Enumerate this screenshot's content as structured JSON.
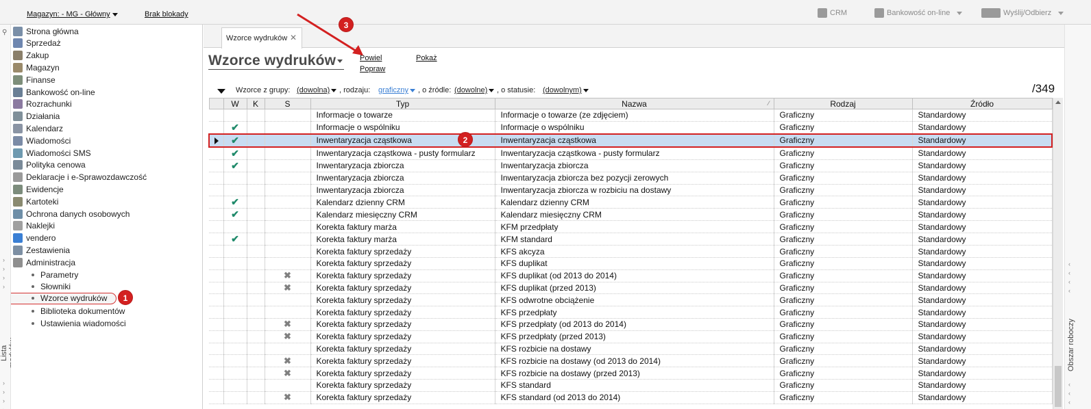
{
  "topbar": {
    "warehouse": "Magazyn: - MG - Główny",
    "lock": "Brak blokady",
    "crm": "CRM",
    "banking": "Bankowość on-line",
    "send": "Wyślij/Odbierz"
  },
  "left_strip": {
    "label": "Lista modułów"
  },
  "right_strip": {
    "label": "Obszar roboczy"
  },
  "sidebar": {
    "modules": [
      {
        "label": "Strona główna",
        "icon": "home-icon"
      },
      {
        "label": "Sprzedaż",
        "icon": "sales-icon"
      },
      {
        "label": "Zakup",
        "icon": "purchase-icon"
      },
      {
        "label": "Magazyn",
        "icon": "warehouse-icon"
      },
      {
        "label": "Finanse",
        "icon": "finance-icon"
      },
      {
        "label": "Bankowość on-line",
        "icon": "bank-icon"
      },
      {
        "label": "Rozrachunki",
        "icon": "settlements-icon"
      },
      {
        "label": "Działania",
        "icon": "actions-icon"
      },
      {
        "label": "Kalendarz",
        "icon": "calendar-icon"
      },
      {
        "label": "Wiadomości",
        "icon": "messages-icon"
      },
      {
        "label": "Wiadomości SMS",
        "icon": "sms-icon"
      },
      {
        "label": "Polityka cenowa",
        "icon": "pricing-icon"
      },
      {
        "label": "Deklaracje i e-Sprawozdawczość",
        "icon": "declarations-icon"
      },
      {
        "label": "Ewidencje",
        "icon": "records-icon"
      },
      {
        "label": "Kartoteki",
        "icon": "cards-icon"
      },
      {
        "label": "Ochrona danych osobowych",
        "icon": "data-protection-icon"
      },
      {
        "label": "Naklejki",
        "icon": "labels-icon"
      },
      {
        "label": "vendero",
        "icon": "vendero-icon"
      },
      {
        "label": "Zestawienia",
        "icon": "reports-icon"
      },
      {
        "label": "Administracja",
        "icon": "admin-icon"
      }
    ],
    "sub_items": [
      {
        "label": "Parametry"
      },
      {
        "label": "Słowniki"
      },
      {
        "label": "Wzorce wydruków"
      },
      {
        "label": "Biblioteka dokumentów"
      },
      {
        "label": "Ustawienia wiadomości"
      }
    ]
  },
  "tab": {
    "label": "Wzorce wydruków"
  },
  "page": {
    "title": "Wzorce wydruków",
    "actions": {
      "duplicate": "Powiel",
      "show": "Pokaż",
      "edit": "Popraw"
    },
    "count": "/349"
  },
  "filters": {
    "group_label": "Wzorce z grupy:",
    "group_value": "(dowolna)",
    "kind_label": ", rodzaju:",
    "kind_value": "graficzny",
    "source_label": ", o źródle:",
    "source_value": "(dowolne)",
    "status_label": ", o statusie:",
    "status_value": "(dowolnym)"
  },
  "annotations": {
    "b1": "1",
    "b2": "2",
    "b3": "3"
  },
  "grid": {
    "columns": [
      "W",
      "K",
      "S",
      "Typ",
      "Nazwa",
      "Rodzaj",
      "Źródło"
    ],
    "rows": [
      {
        "w": "",
        "s": "",
        "typ": "Informacje o towarze",
        "nazwa": "Informacje o towarze (ze zdjęciem)",
        "rodzaj": "Graficzny",
        "zrodlo": "Standardowy"
      },
      {
        "w": "✔",
        "s": "",
        "typ": "Informacje o wspólniku",
        "nazwa": "Informacje o wspólniku",
        "rodzaj": "Graficzny",
        "zrodlo": "Standardowy"
      },
      {
        "w": "✔",
        "s": "",
        "typ": "Inwentaryzacja cząstkowa",
        "nazwa": "Inwentaryzacja cząstkowa",
        "rodzaj": "Graficzny",
        "zrodlo": "Standardowy",
        "selected": true
      },
      {
        "w": "✔",
        "s": "",
        "typ": "Inwentaryzacja cząstkowa - pusty formularz",
        "nazwa": "Inwentaryzacja cząstkowa - pusty formularz",
        "rodzaj": "Graficzny",
        "zrodlo": "Standardowy"
      },
      {
        "w": "✔",
        "s": "",
        "typ": "Inwentaryzacja zbiorcza",
        "nazwa": "Inwentaryzacja zbiorcza",
        "rodzaj": "Graficzny",
        "zrodlo": "Standardowy"
      },
      {
        "w": "",
        "s": "",
        "typ": "Inwentaryzacja zbiorcza",
        "nazwa": "Inwentaryzacja zbiorcza bez pozycji zerowych",
        "rodzaj": "Graficzny",
        "zrodlo": "Standardowy"
      },
      {
        "w": "",
        "s": "",
        "typ": "Inwentaryzacja zbiorcza",
        "nazwa": "Inwentaryzacja zbiorcza w rozbiciu na dostawy",
        "rodzaj": "Graficzny",
        "zrodlo": "Standardowy"
      },
      {
        "w": "✔",
        "s": "",
        "typ": "Kalendarz dzienny CRM",
        "nazwa": "Kalendarz dzienny CRM",
        "rodzaj": "Graficzny",
        "zrodlo": "Standardowy"
      },
      {
        "w": "✔",
        "s": "",
        "typ": "Kalendarz miesięczny CRM",
        "nazwa": "Kalendarz miesięczny CRM",
        "rodzaj": "Graficzny",
        "zrodlo": "Standardowy"
      },
      {
        "w": "",
        "s": "",
        "typ": "Korekta faktury marża",
        "nazwa": "KFM przedpłaty",
        "rodzaj": "Graficzny",
        "zrodlo": "Standardowy"
      },
      {
        "w": "✔",
        "s": "",
        "typ": "Korekta faktury marża",
        "nazwa": "KFM standard",
        "rodzaj": "Graficzny",
        "zrodlo": "Standardowy"
      },
      {
        "w": "",
        "s": "",
        "typ": "Korekta faktury sprzedaży",
        "nazwa": "KFS akcyza",
        "rodzaj": "Graficzny",
        "zrodlo": "Standardowy"
      },
      {
        "w": "",
        "s": "",
        "typ": "Korekta faktury sprzedaży",
        "nazwa": "KFS duplikat",
        "rodzaj": "Graficzny",
        "zrodlo": "Standardowy"
      },
      {
        "w": "",
        "s": "✖",
        "typ": "Korekta faktury sprzedaży",
        "nazwa": "KFS duplikat (od 2013 do 2014)",
        "rodzaj": "Graficzny",
        "zrodlo": "Standardowy"
      },
      {
        "w": "",
        "s": "✖",
        "typ": "Korekta faktury sprzedaży",
        "nazwa": "KFS duplikat (przed 2013)",
        "rodzaj": "Graficzny",
        "zrodlo": "Standardowy"
      },
      {
        "w": "",
        "s": "",
        "typ": "Korekta faktury sprzedaży",
        "nazwa": "KFS odwrotne obciążenie",
        "rodzaj": "Graficzny",
        "zrodlo": "Standardowy"
      },
      {
        "w": "",
        "s": "",
        "typ": "Korekta faktury sprzedaży",
        "nazwa": "KFS przedpłaty",
        "rodzaj": "Graficzny",
        "zrodlo": "Standardowy"
      },
      {
        "w": "",
        "s": "✖",
        "typ": "Korekta faktury sprzedaży",
        "nazwa": "KFS przedpłaty (od 2013 do 2014)",
        "rodzaj": "Graficzny",
        "zrodlo": "Standardowy"
      },
      {
        "w": "",
        "s": "✖",
        "typ": "Korekta faktury sprzedaży",
        "nazwa": "KFS przedpłaty (przed 2013)",
        "rodzaj": "Graficzny",
        "zrodlo": "Standardowy"
      },
      {
        "w": "",
        "s": "",
        "typ": "Korekta faktury sprzedaży",
        "nazwa": "KFS rozbicie na dostawy",
        "rodzaj": "Graficzny",
        "zrodlo": "Standardowy"
      },
      {
        "w": "",
        "s": "✖",
        "typ": "Korekta faktury sprzedaży",
        "nazwa": "KFS rozbicie na dostawy (od 2013 do 2014)",
        "rodzaj": "Graficzny",
        "zrodlo": "Standardowy"
      },
      {
        "w": "",
        "s": "✖",
        "typ": "Korekta faktury sprzedaży",
        "nazwa": "KFS rozbicie na dostawy (przed 2013)",
        "rodzaj": "Graficzny",
        "zrodlo": "Standardowy"
      },
      {
        "w": "",
        "s": "",
        "typ": "Korekta faktury sprzedaży",
        "nazwa": "KFS standard",
        "rodzaj": "Graficzny",
        "zrodlo": "Standardowy"
      },
      {
        "w": "",
        "s": "✖",
        "typ": "Korekta faktury sprzedaży",
        "nazwa": "KFS standard (od 2013 do 2014)",
        "rodzaj": "Graficzny",
        "zrodlo": "Standardowy"
      }
    ]
  },
  "colors": {
    "accent_red": "#d32020",
    "selection": "#c8dcf1",
    "check_green": "#1f8a6a"
  }
}
